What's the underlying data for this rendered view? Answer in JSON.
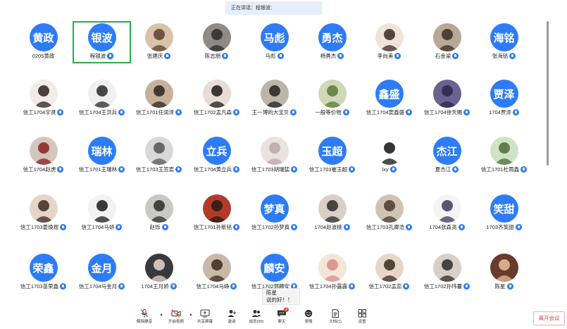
{
  "speaking_banner": "正在讲话：程银波;",
  "colors": {
    "avatar_blue": "#2d7cf6",
    "active_border": "#22b14c",
    "leave_red": "#e03b3b"
  },
  "participants": [
    [
      {
        "avatar_text": "黄政",
        "name": "0205黄政",
        "mic": false
      },
      {
        "avatar_text": "银波",
        "name": "程银波",
        "mic": true,
        "active": true
      },
      {
        "photo": "p1",
        "name": "张建庆",
        "mic": true
      },
      {
        "photo": "p2",
        "name": "陈志朋",
        "mic": true
      },
      {
        "avatar_text": "马彪",
        "name": "马彪",
        "mic": true
      },
      {
        "avatar_text": "勇杰",
        "name": "杨勇杰",
        "mic": true
      },
      {
        "photo": "p3",
        "name": "李尚美",
        "mic": true
      },
      {
        "photo": "p4",
        "name": "石金梁",
        "mic": true
      },
      {
        "avatar_text": "海铭",
        "name": "张海铭",
        "mic": true
      }
    ],
    [
      {
        "photo": "p5",
        "name": "信工1704宇贤",
        "mic": true
      },
      {
        "photo": "p6",
        "name": "信工1704王洪兵",
        "mic": true
      },
      {
        "photo": "p7",
        "name": "信工1701任润泽",
        "mic": true
      },
      {
        "photo": "p8",
        "name": "信工1702孟凡森",
        "mic": true
      },
      {
        "photo": "p9",
        "name": "王一博的大宝贝",
        "mic": true
      },
      {
        "photo": "p10",
        "name": "一般等价物",
        "mic": true
      },
      {
        "avatar_text": "鑫盛",
        "name": "信工1704窦鑫盛",
        "mic": true
      },
      {
        "photo": "p11",
        "name": "信工1704徐天赐",
        "mic": true
      },
      {
        "avatar_text": "贾泽",
        "name": "1704贾泽",
        "mic": true
      }
    ],
    [
      {
        "photo": "p12",
        "name": "信工1704赵虎",
        "mic": true
      },
      {
        "avatar_text": "瑞林",
        "name": "信工1701王瑞林",
        "mic": true
      },
      {
        "photo": "p13",
        "name": "信工1703王笠宸",
        "mic": true
      },
      {
        "avatar_text": "立兵",
        "name": "信工1704黄立兵",
        "mic": true
      },
      {
        "photo": "p14",
        "name": "信工1703胡瑞猛",
        "mic": true
      },
      {
        "avatar_text": "玉超",
        "name": "信工1703崔玉超",
        "mic": true
      },
      {
        "photo": "p15",
        "name": "lxy",
        "mic": true
      },
      {
        "avatar_text": "杰江",
        "name": "夏杰江",
        "mic": true
      },
      {
        "photo": "p16",
        "name": "信工1701杜雨鑫",
        "mic": true
      }
    ],
    [
      {
        "photo": "p17",
        "name": "信工1703姜焕煜",
        "mic": true
      },
      {
        "photo": "p18",
        "name": "信工1704马妍",
        "mic": true
      },
      {
        "photo": "p19",
        "name": "赵烁",
        "mic": true
      },
      {
        "photo": "p20",
        "name": "信工1701孙新铭",
        "mic": true
      },
      {
        "avatar_text": "梦真",
        "name": "信工1702孙梦真",
        "mic": true
      },
      {
        "photo": "p21",
        "name": "1704赵波桃",
        "mic": true
      },
      {
        "photo": "p22",
        "name": "信工1703孔卿浩",
        "mic": true
      },
      {
        "photo": "p23",
        "name": "1704张森尧",
        "mic": true
      },
      {
        "avatar_text": "笑甜",
        "name": "1703齐笑甜",
        "mic": true
      }
    ],
    [
      {
        "avatar_text": "荣鑫",
        "name": "信工1703苗荣鑫",
        "mic": true
      },
      {
        "avatar_text": "金月",
        "name": "信工1704马金月",
        "mic": true
      },
      {
        "photo": "p24",
        "name": "1704王月娇",
        "mic": true
      },
      {
        "photo": "p25",
        "name": "信工1704马峥",
        "mic": true
      },
      {
        "avatar_text": "麟安",
        "name": "信工1702郭麟安",
        "mic": true
      },
      {
        "photo": "p26",
        "name": "信工1704孙露露",
        "mic": true
      },
      {
        "photo": "p27",
        "name": "信工1702孟蕊",
        "mic": true
      },
      {
        "photo": "p28",
        "name": "信工1702孙玮蔓",
        "mic": true
      },
      {
        "photo": "p29",
        "name": "陈星",
        "mic": true
      }
    ]
  ],
  "chat_popup": {
    "sender": "陈星",
    "message": "说的好！！"
  },
  "toolbar": {
    "unmute": "解除静音",
    "start_video": "开启视频",
    "share_screen": "共享屏幕",
    "invite": "邀请",
    "members": "成员(90)",
    "chat": "聊天",
    "chat_badge": "3",
    "emoji": "表情",
    "docs": "文档(1)",
    "settings": "设置",
    "leave": "离开会议"
  }
}
